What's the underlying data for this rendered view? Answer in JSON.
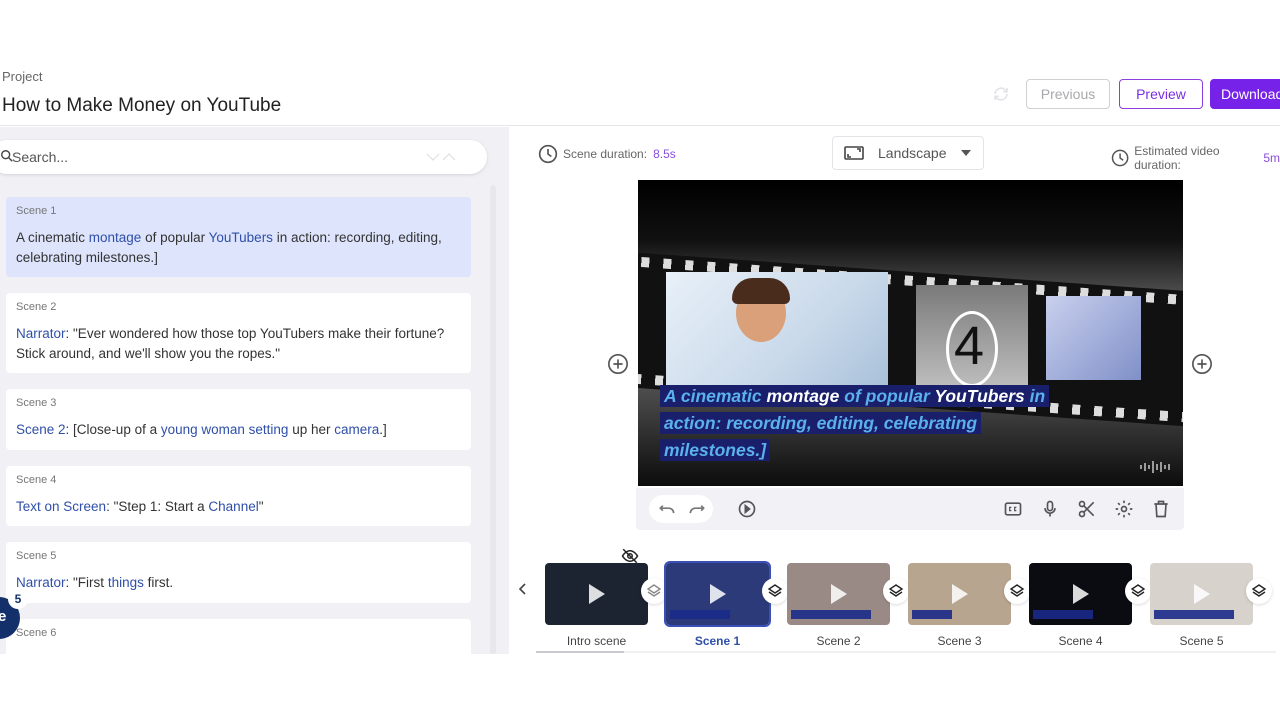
{
  "header": {
    "project_label": "Project",
    "project_title": "How to Make Money on YouTube",
    "buttons": {
      "previous": "Previous",
      "preview": "Preview",
      "download": "Download"
    },
    "colors": {
      "accent": "#7622e8"
    }
  },
  "sidebar": {
    "search": {
      "placeholder": "Search...",
      "value": ""
    },
    "scenes": [
      {
        "label": "Scene 1",
        "active": true,
        "text_parts": [
          {
            "t": "A cinematic ",
            "k": false
          },
          {
            "t": "montage",
            "k": true
          },
          {
            "t": " of popular ",
            "k": false
          },
          {
            "t": "YouTubers",
            "k": true
          },
          {
            "t": " in action: recording, editing, celebrating milestones.]",
            "k": false
          }
        ]
      },
      {
        "label": "Scene 2",
        "active": false,
        "text_parts": [
          {
            "t": "Narrator",
            "k": true
          },
          {
            "t": ": \"Ever wondered how those top YouTubers make their fortune? Stick around, and we'll show you the ropes.\"",
            "k": false
          }
        ]
      },
      {
        "label": "Scene 3",
        "active": false,
        "text_parts": [
          {
            "t": "Scene 2",
            "k": true
          },
          {
            "t": ": [Close-up of a ",
            "k": false
          },
          {
            "t": "young woman setting",
            "k": true
          },
          {
            "t": " up her ",
            "k": false
          },
          {
            "t": "camera",
            "k": true
          },
          {
            "t": ".]",
            "k": false
          }
        ]
      },
      {
        "label": "Scene 4",
        "active": false,
        "text_parts": [
          {
            "t": "Text on Screen",
            "k": true
          },
          {
            "t": ": \"Step 1: Start a ",
            "k": false
          },
          {
            "t": "Channel",
            "k": true
          },
          {
            "t": "\"",
            "k": false
          }
        ]
      },
      {
        "label": "Scene 5",
        "active": false,
        "text_parts": [
          {
            "t": "Narrator",
            "k": true
          },
          {
            "t": ": \"First ",
            "k": false
          },
          {
            "t": "things",
            "k": true
          },
          {
            "t": " first.",
            "k": false
          }
        ]
      },
      {
        "label": "Scene 6",
        "active": false,
        "text_parts": []
      }
    ],
    "floating_badge": {
      "letter": "e",
      "count": "5"
    }
  },
  "editor": {
    "scene_duration_label": "Scene duration:",
    "scene_duration_value": "8.5s",
    "orientation": "Landscape",
    "estimated_label": "Estimated video duration:",
    "estimated_value": "5m",
    "caption_lines": [
      [
        {
          "t": "A cinematic ",
          "w": false
        },
        {
          "t": "montage",
          "w": true
        },
        {
          "t": " of popular ",
          "w": false
        },
        {
          "t": "YouTubers",
          "w": true
        },
        {
          "t": " in",
          "w": false
        }
      ],
      [
        {
          "t": "action: recording, editing, celebrating",
          "w": false
        }
      ],
      [
        {
          "t": "milestones.]",
          "w": false
        }
      ]
    ],
    "toolbar_icons": [
      "undo-icon",
      "redo-icon",
      "play-icon",
      "captions-icon",
      "microphone-icon",
      "scissors-icon",
      "settings-icon",
      "trash-icon"
    ]
  },
  "timeline": {
    "thumbnails": [
      {
        "label": "Intro scene",
        "active": false,
        "bg": "#1b2430"
      },
      {
        "label": "Scene 1",
        "active": true,
        "bg": "#2d3a7a"
      },
      {
        "label": "Scene 2",
        "active": false,
        "bg": "#9a8a86"
      },
      {
        "label": "Scene 3",
        "active": false,
        "bg": "#b8a590"
      },
      {
        "label": "Scene 4",
        "active": false,
        "bg": "#0b0b12"
      },
      {
        "label": "Scene 5",
        "active": false,
        "bg": "#d8d2cc"
      }
    ]
  }
}
